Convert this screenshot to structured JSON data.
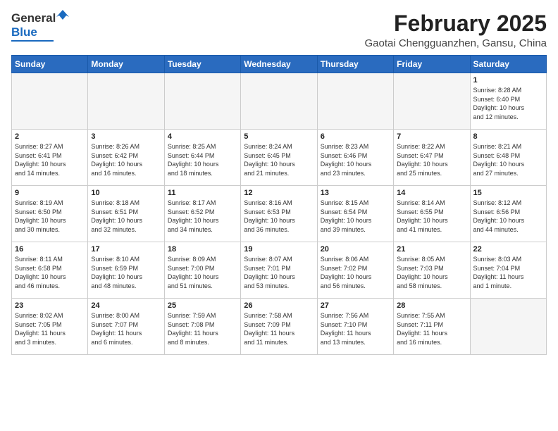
{
  "header": {
    "logo_general": "General",
    "logo_blue": "Blue",
    "month_title": "February 2025",
    "location": "Gaotai Chengguanzhen, Gansu, China"
  },
  "weekdays": [
    "Sunday",
    "Monday",
    "Tuesday",
    "Wednesday",
    "Thursday",
    "Friday",
    "Saturday"
  ],
  "weeks": [
    [
      {
        "day": "",
        "info": ""
      },
      {
        "day": "",
        "info": ""
      },
      {
        "day": "",
        "info": ""
      },
      {
        "day": "",
        "info": ""
      },
      {
        "day": "",
        "info": ""
      },
      {
        "day": "",
        "info": ""
      },
      {
        "day": "1",
        "info": "Sunrise: 8:28 AM\nSunset: 6:40 PM\nDaylight: 10 hours\nand 12 minutes."
      }
    ],
    [
      {
        "day": "2",
        "info": "Sunrise: 8:27 AM\nSunset: 6:41 PM\nDaylight: 10 hours\nand 14 minutes."
      },
      {
        "day": "3",
        "info": "Sunrise: 8:26 AM\nSunset: 6:42 PM\nDaylight: 10 hours\nand 16 minutes."
      },
      {
        "day": "4",
        "info": "Sunrise: 8:25 AM\nSunset: 6:44 PM\nDaylight: 10 hours\nand 18 minutes."
      },
      {
        "day": "5",
        "info": "Sunrise: 8:24 AM\nSunset: 6:45 PM\nDaylight: 10 hours\nand 21 minutes."
      },
      {
        "day": "6",
        "info": "Sunrise: 8:23 AM\nSunset: 6:46 PM\nDaylight: 10 hours\nand 23 minutes."
      },
      {
        "day": "7",
        "info": "Sunrise: 8:22 AM\nSunset: 6:47 PM\nDaylight: 10 hours\nand 25 minutes."
      },
      {
        "day": "8",
        "info": "Sunrise: 8:21 AM\nSunset: 6:48 PM\nDaylight: 10 hours\nand 27 minutes."
      }
    ],
    [
      {
        "day": "9",
        "info": "Sunrise: 8:19 AM\nSunset: 6:50 PM\nDaylight: 10 hours\nand 30 minutes."
      },
      {
        "day": "10",
        "info": "Sunrise: 8:18 AM\nSunset: 6:51 PM\nDaylight: 10 hours\nand 32 minutes."
      },
      {
        "day": "11",
        "info": "Sunrise: 8:17 AM\nSunset: 6:52 PM\nDaylight: 10 hours\nand 34 minutes."
      },
      {
        "day": "12",
        "info": "Sunrise: 8:16 AM\nSunset: 6:53 PM\nDaylight: 10 hours\nand 36 minutes."
      },
      {
        "day": "13",
        "info": "Sunrise: 8:15 AM\nSunset: 6:54 PM\nDaylight: 10 hours\nand 39 minutes."
      },
      {
        "day": "14",
        "info": "Sunrise: 8:14 AM\nSunset: 6:55 PM\nDaylight: 10 hours\nand 41 minutes."
      },
      {
        "day": "15",
        "info": "Sunrise: 8:12 AM\nSunset: 6:56 PM\nDaylight: 10 hours\nand 44 minutes."
      }
    ],
    [
      {
        "day": "16",
        "info": "Sunrise: 8:11 AM\nSunset: 6:58 PM\nDaylight: 10 hours\nand 46 minutes."
      },
      {
        "day": "17",
        "info": "Sunrise: 8:10 AM\nSunset: 6:59 PM\nDaylight: 10 hours\nand 48 minutes."
      },
      {
        "day": "18",
        "info": "Sunrise: 8:09 AM\nSunset: 7:00 PM\nDaylight: 10 hours\nand 51 minutes."
      },
      {
        "day": "19",
        "info": "Sunrise: 8:07 AM\nSunset: 7:01 PM\nDaylight: 10 hours\nand 53 minutes."
      },
      {
        "day": "20",
        "info": "Sunrise: 8:06 AM\nSunset: 7:02 PM\nDaylight: 10 hours\nand 56 minutes."
      },
      {
        "day": "21",
        "info": "Sunrise: 8:05 AM\nSunset: 7:03 PM\nDaylight: 10 hours\nand 58 minutes."
      },
      {
        "day": "22",
        "info": "Sunrise: 8:03 AM\nSunset: 7:04 PM\nDaylight: 11 hours\nand 1 minute."
      }
    ],
    [
      {
        "day": "23",
        "info": "Sunrise: 8:02 AM\nSunset: 7:05 PM\nDaylight: 11 hours\nand 3 minutes."
      },
      {
        "day": "24",
        "info": "Sunrise: 8:00 AM\nSunset: 7:07 PM\nDaylight: 11 hours\nand 6 minutes."
      },
      {
        "day": "25",
        "info": "Sunrise: 7:59 AM\nSunset: 7:08 PM\nDaylight: 11 hours\nand 8 minutes."
      },
      {
        "day": "26",
        "info": "Sunrise: 7:58 AM\nSunset: 7:09 PM\nDaylight: 11 hours\nand 11 minutes."
      },
      {
        "day": "27",
        "info": "Sunrise: 7:56 AM\nSunset: 7:10 PM\nDaylight: 11 hours\nand 13 minutes."
      },
      {
        "day": "28",
        "info": "Sunrise: 7:55 AM\nSunset: 7:11 PM\nDaylight: 11 hours\nand 16 minutes."
      },
      {
        "day": "",
        "info": ""
      }
    ]
  ]
}
